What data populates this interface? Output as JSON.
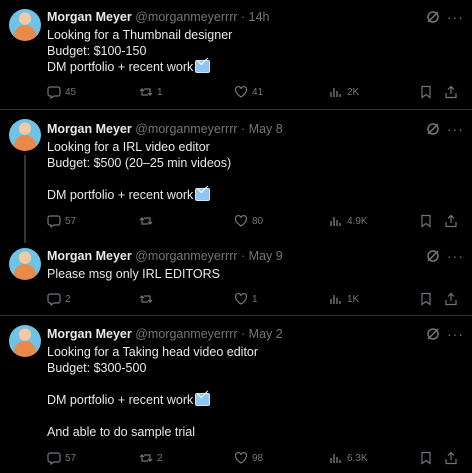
{
  "tweets": [
    {
      "name": "Morgan Meyer",
      "handle": "@morganmeyerrrr",
      "time": "· 14h",
      "lines": [
        "Looking for a Thumbnail designer",
        "Budget: $100-150",
        "DM portfolio + recent work"
      ],
      "replies": "45",
      "retweets": "1",
      "likes": "41",
      "views": "2K"
    },
    {
      "name": "Morgan Meyer",
      "handle": "@morganmeyerrrr",
      "time": "· May 8",
      "lines": [
        "Looking for a IRL video editor",
        "Budget: $500 (20–25 min videos)",
        "",
        "DM portfolio + recent work"
      ],
      "replies": "57",
      "retweets": "",
      "likes": "80",
      "views": "4.9K"
    },
    {
      "name": "Morgan Meyer",
      "handle": "@morganmeyerrrr",
      "time": "· May 9",
      "lines": [
        "Please msg only IRL EDITORS"
      ],
      "replies": "2",
      "retweets": "",
      "likes": "1",
      "views": "1K"
    },
    {
      "name": "Morgan Meyer",
      "handle": "@morganmeyerrrr",
      "time": "· May 2",
      "lines": [
        "Looking for a Taking head video editor",
        "Budget: $300-500",
        "",
        "DM portfolio + recent work",
        "",
        "And able to do sample trial"
      ],
      "replies": "57",
      "retweets": "2",
      "likes": "98",
      "views": "6.3K"
    }
  ],
  "icons": {
    "reply": "reply-icon",
    "retweet": "retweet-icon",
    "like": "heart-icon",
    "views": "views-icon",
    "bookmark": "bookmark-icon",
    "share": "share-icon",
    "grok": "grok-icon",
    "more": "more-icon",
    "envelope": "envelope-emoji"
  },
  "colors": {
    "background": "#000000",
    "muted": "#71767b",
    "text": "#e7e9ea",
    "divider": "#2f3336"
  }
}
